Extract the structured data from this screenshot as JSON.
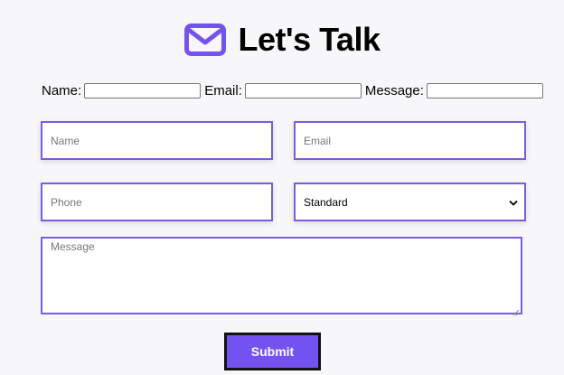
{
  "header": {
    "icon": "mail-icon",
    "title": "Let's Talk"
  },
  "simple_form": {
    "name_label": "Name:",
    "email_label": "Email:",
    "message_label": "Message:"
  },
  "styled_form": {
    "name_placeholder": "Name",
    "email_placeholder": "Email",
    "phone_placeholder": "Phone",
    "select_value": "Standard",
    "message_placeholder": "Message",
    "submit_label": "Submit"
  },
  "colors": {
    "accent": "#7452f0",
    "field_border": "#7b5ce0",
    "background": "#f7f7f9"
  }
}
